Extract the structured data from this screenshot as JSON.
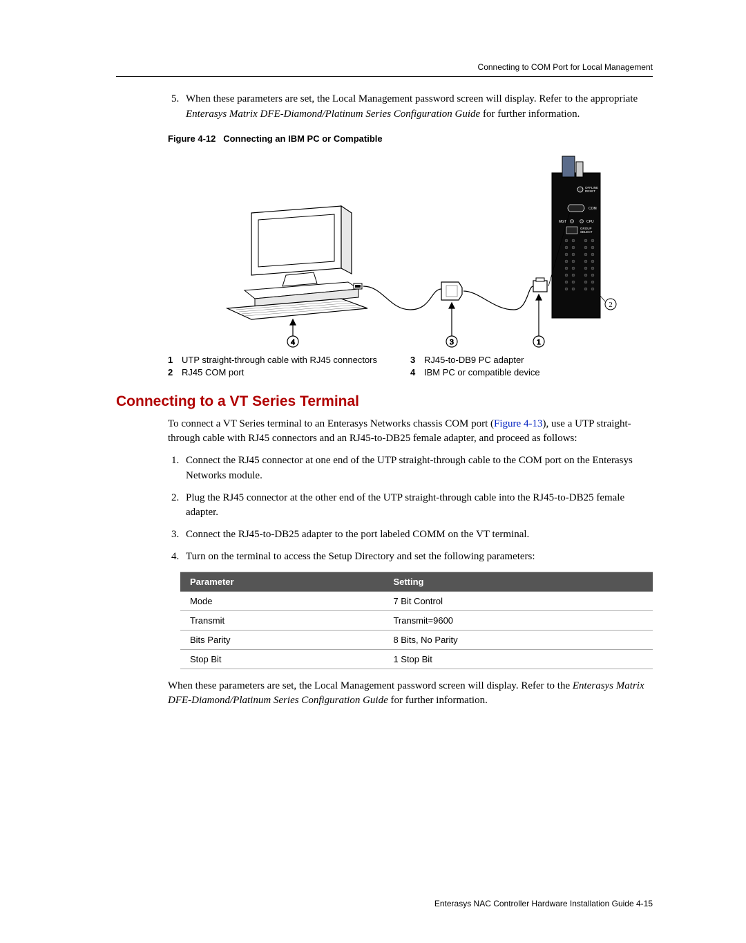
{
  "running_header": "Connecting to COM Port for Local Management",
  "step5": {
    "number": "5.",
    "text_a": "When these parameters are set, the Local Management password screen will display. Refer to the appropriate ",
    "text_italic": "Enterasys Matrix DFE-Diamond/Platinum Series Configuration Guide",
    "text_b": " for further information."
  },
  "figure": {
    "label": "Figure 4-12",
    "title": "Connecting an IBM PC or Compatible",
    "front_labels": {
      "offline": "OFFLINE",
      "reset": "RESET",
      "com": "COM",
      "mgt": "MGT",
      "cpu": "CPU",
      "group": "GROUP",
      "select": "SELECT"
    }
  },
  "legend": {
    "1": "UTP straight-through cable with RJ45 connectors",
    "2": "RJ45 COM port",
    "3": "RJ45-to-DB9 PC adapter",
    "4": "IBM PC or compatible device"
  },
  "section_heading": "Connecting to a VT Series Terminal",
  "intro": {
    "a": "To connect a VT Series terminal to an Enterasys Networks chassis COM port (",
    "link": "Figure 4-13",
    "b": "), use a UTP straight-through cable with RJ45 connectors and an RJ45-to-DB25 female adapter, and proceed as follows:"
  },
  "steps": {
    "1": "Connect the RJ45 connector at one end of the UTP straight-through cable to the COM port on the Enterasys Networks module.",
    "2": "Plug the RJ45 connector at the other end of the UTP straight-through cable into the RJ45-to-DB25 female adapter.",
    "3": "Connect the RJ45-to-DB25 adapter to the port labeled COMM on the VT terminal.",
    "4": "Turn on the terminal to access the Setup Directory and set the following parameters:"
  },
  "table": {
    "headers": {
      "param": "Parameter",
      "setting": "Setting"
    },
    "rows": [
      {
        "param": "Mode",
        "setting": "7 Bit Control"
      },
      {
        "param": "Transmit",
        "setting": "Transmit=9600"
      },
      {
        "param": "Bits Parity",
        "setting": "8 Bits, No Parity"
      },
      {
        "param": "Stop Bit",
        "setting": "1 Stop Bit"
      }
    ]
  },
  "closing": {
    "a": "When these parameters are set, the Local Management password screen will display. Refer to the ",
    "italic": "Enterasys Matrix DFE-Diamond/Platinum Series Configuration Guide",
    "b": " for further information."
  },
  "footer": "Enterasys NAC Controller Hardware Installation Guide   4-15",
  "chart_data": {
    "type": "table",
    "title": "VT Series Terminal Setup Parameters",
    "columns": [
      "Parameter",
      "Setting"
    ],
    "rows": [
      [
        "Mode",
        "7 Bit Control"
      ],
      [
        "Transmit",
        "Transmit=9600"
      ],
      [
        "Bits Parity",
        "8 Bits, No Parity"
      ],
      [
        "Stop Bit",
        "1 Stop Bit"
      ]
    ]
  }
}
